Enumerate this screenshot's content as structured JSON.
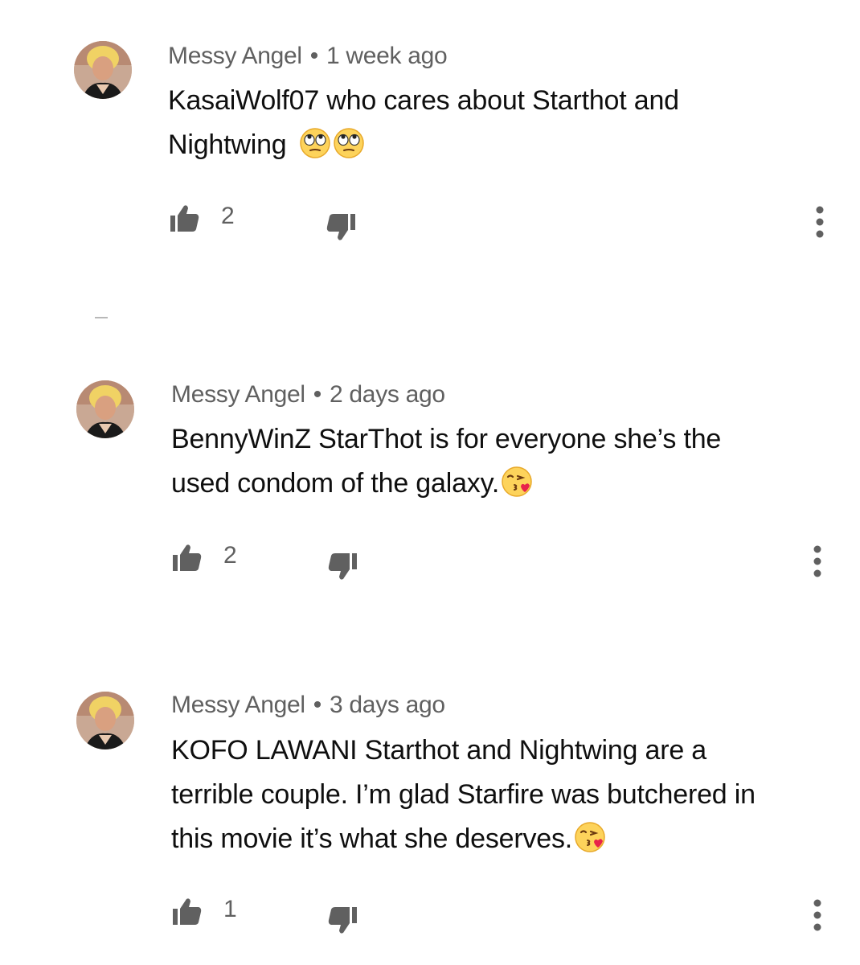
{
  "comments": [
    {
      "author": "Messy Angel",
      "time": "1 week ago",
      "text": [
        "KasaiWolf07 who cares about Starthot and",
        "Nightwing"
      ],
      "emoji": [
        "face-with-rolling-eyes",
        "face-with-rolling-eyes"
      ],
      "likes": "2"
    },
    {
      "author": "Messy Angel",
      "time": "2 days ago",
      "text": [
        "BennyWinZ StarThot is for everyone she’s the",
        "used condom of the galaxy."
      ],
      "emoji": [
        "face-blowing-a-kiss"
      ],
      "likes": "2"
    },
    {
      "author": "Messy Angel",
      "time": "3 days ago",
      "text": [
        "KOFO LAWANI Starthot and Nightwing are a",
        "terrible couple. I’m glad Starfire was butchered in",
        "this movie it’s what she deserves."
      ],
      "emoji": [
        "face-blowing-a-kiss"
      ],
      "likes": "1"
    }
  ],
  "colors": {
    "meta_text": "#606060",
    "body_text": "#0f0f0f",
    "icon": "#606060"
  }
}
